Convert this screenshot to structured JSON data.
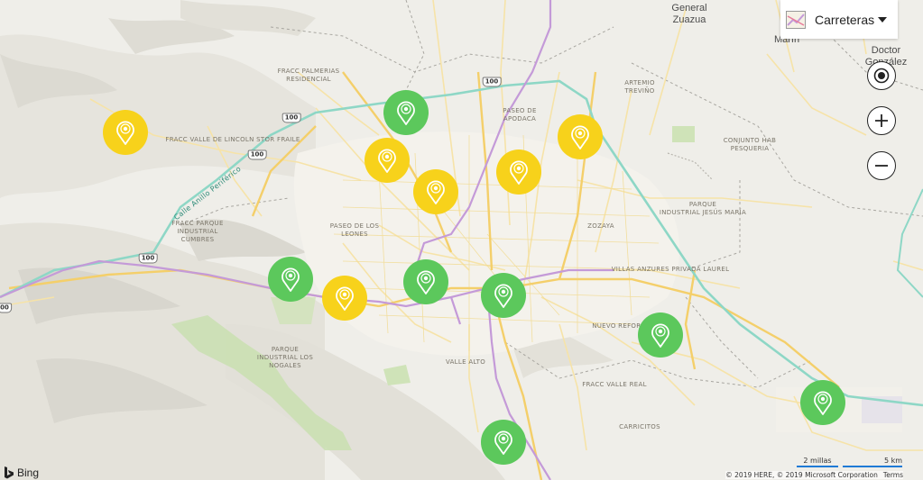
{
  "map": {
    "style_picker": {
      "label": "Carreteras"
    },
    "labels": {
      "general_zuazua": "General\nZuazua",
      "marin": "Marín",
      "doctor_gonzalez": "Doctor\nGonzález",
      "fracc_palmerias": "FRACC PALMERIAS\nRESIDENCIAL",
      "artemio_trevino": "ARTEMIO\nTREVIÑO",
      "paseo_apodaca": "PASEO DE\nAPODACA",
      "fracc_valle_lincoln": "FRACC VALLE DE LINCOLN STOR FRAILE",
      "conjunto_hab": "CONJUNTO HAB\nPESQUERIA",
      "calle_anillo": "Calle Anillo Periférico",
      "parque_jesus_maria": "PARQUE\nINDUSTRIAL JESÚS MARÍA",
      "fracc_parque_cumbres": "FRACC PARQUE\nINDUSTRIAL\nCUMBRES",
      "paseo_leones": "PASEO DE LOS\nLEONES",
      "zozaya": "ZOZAYA",
      "villas_anzures": "VILLAS ANZURES PRIVADA LAUREL",
      "nuevo_reforma": "NUEVO REFORMA",
      "parque_nogales": "PARQUE\nINDUSTRIAL LOS\nNOGALES",
      "valle_alto": "VALLE ALTO",
      "fracc_valle_real": "FRACC VALLE REAL",
      "carricitos": "CARRICITOS"
    },
    "shields": [
      "100",
      "100",
      "100",
      "100",
      "100"
    ],
    "edge_shield": "00",
    "pin_colors": {
      "green": "#5cc85c",
      "yellow": "#f7d21b"
    },
    "pins": [
      {
        "color": "yellow",
        "lon": -100.455,
        "lat": 25.845
      },
      {
        "color": "green",
        "lon": -100.231,
        "lat": 25.861
      },
      {
        "color": "yellow",
        "lon": -100.246,
        "lat": 25.823
      },
      {
        "color": "yellow",
        "lon": -100.207,
        "lat": 25.798
      },
      {
        "color": "yellow",
        "lon": -100.141,
        "lat": 25.814
      },
      {
        "color": "yellow",
        "lon": -100.092,
        "lat": 25.842
      },
      {
        "color": "green",
        "lon": -100.323,
        "lat": 25.729
      },
      {
        "color": "yellow",
        "lon": -100.28,
        "lat": 25.714
      },
      {
        "color": "green",
        "lon": -100.215,
        "lat": 25.727
      },
      {
        "color": "green",
        "lon": -100.153,
        "lat": 25.716
      },
      {
        "color": "green",
        "lon": -100.028,
        "lat": 25.685
      },
      {
        "color": "green",
        "lon": -99.898,
        "lat": 25.631
      },
      {
        "color": "green",
        "lon": -100.153,
        "lat": 25.6
      }
    ],
    "controls": {
      "locate_icon": "locate-me-icon",
      "zoom_in_icon": "plus-icon",
      "zoom_out_icon": "minus-icon"
    },
    "brand": "Bing",
    "scale": {
      "miles": "2 millas",
      "km": "5 km"
    },
    "copyright": "© 2019 HERE, © 2019 Microsoft Corporation",
    "terms": "Terms"
  }
}
